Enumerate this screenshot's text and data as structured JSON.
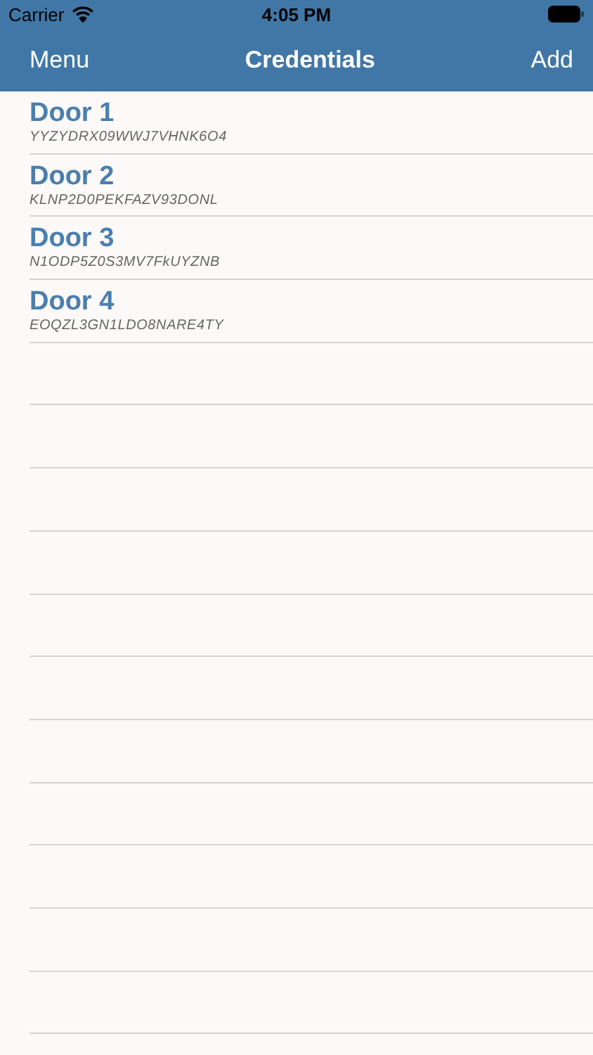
{
  "status_bar": {
    "carrier": "Carrier",
    "time": "4:05 PM"
  },
  "nav_bar": {
    "left_button": "Menu",
    "title": "Credentials",
    "right_button": "Add"
  },
  "credentials": [
    {
      "name": "Door 1",
      "code": "YYZYDRX09WWJ7VHNK6O4"
    },
    {
      "name": "Door 2",
      "code": "KLNP2D0PEKFAZV93DONL"
    },
    {
      "name": "Door 3",
      "code": "N1ODP5Z0S3MV7FkUYZNB"
    },
    {
      "name": "Door 4",
      "code": "EOQZL3GN1LDO8NARE4TY"
    }
  ]
}
